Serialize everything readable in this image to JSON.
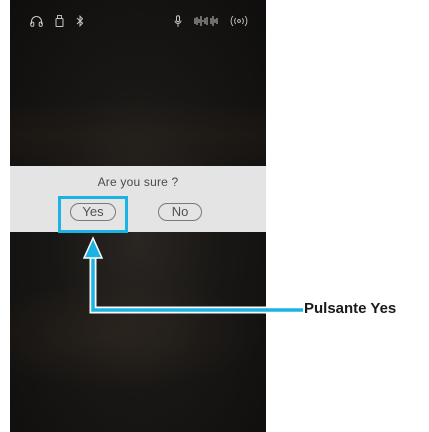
{
  "status_bar": {
    "icons": [
      "headphones-icon",
      "usb-drive-icon",
      "bluetooth-icon",
      "microphone-icon",
      "audio-recorder-icon",
      "wireless-icon"
    ]
  },
  "dialog": {
    "title": "Are you sure ?",
    "yes_label": "Yes",
    "no_label": "No"
  },
  "callout": {
    "label": "Pulsante Yes",
    "color": "#1bb3e3"
  }
}
